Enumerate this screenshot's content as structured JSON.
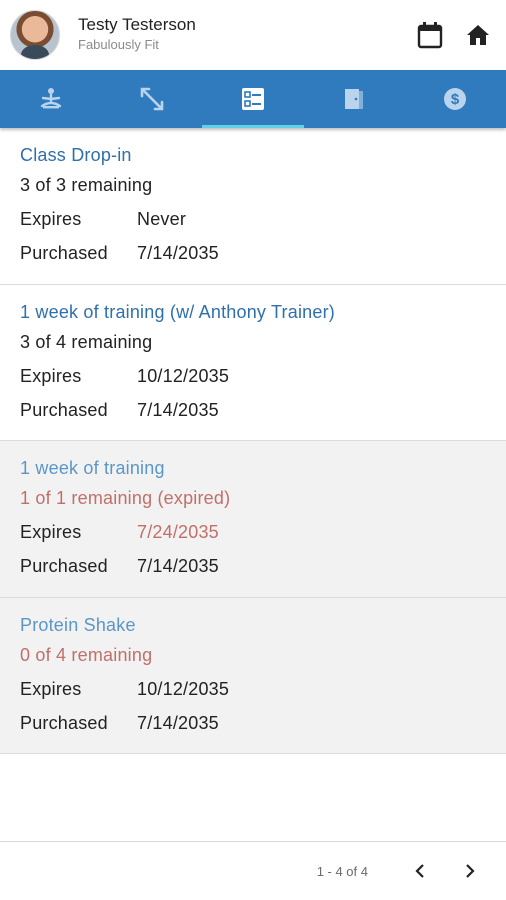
{
  "header": {
    "user_name": "Testy Testerson",
    "gym_name": "Fabulously Fit"
  },
  "tabs": [
    {
      "icon": "meditation-icon",
      "active": false
    },
    {
      "icon": "fitness-arrows-icon",
      "active": false
    },
    {
      "icon": "checklist-icon",
      "active": true
    },
    {
      "icon": "door-icon",
      "active": false
    },
    {
      "icon": "dollar-icon",
      "active": false
    }
  ],
  "labels": {
    "expires": "Expires",
    "purchased": "Purchased"
  },
  "packages": [
    {
      "title": "Class Drop-in",
      "remaining": "3 of 3 remaining",
      "expires": "Never",
      "purchased": "7/14/2035",
      "expired": false
    },
    {
      "title": "1 week of training (w/ Anthony Trainer)",
      "remaining": "3 of 4 remaining",
      "expires": "10/12/2035",
      "purchased": "7/14/2035",
      "expired": false
    },
    {
      "title": "1 week of training",
      "remaining": "1 of 1 remaining (expired)",
      "expires": "7/24/2035",
      "purchased": "7/14/2035",
      "expired": true
    },
    {
      "title": "Protein Shake",
      "remaining": "0 of 4 remaining",
      "expires": "10/12/2035",
      "purchased": "7/14/2035",
      "expired": true
    }
  ],
  "pagination": {
    "range": "1 - 4 of 4"
  },
  "colors": {
    "tab_bar": "#2f7bbd",
    "tab_indicator": "#5fd0e6",
    "title_blue": "#2f6fad",
    "expired_red": "#c0706a"
  }
}
